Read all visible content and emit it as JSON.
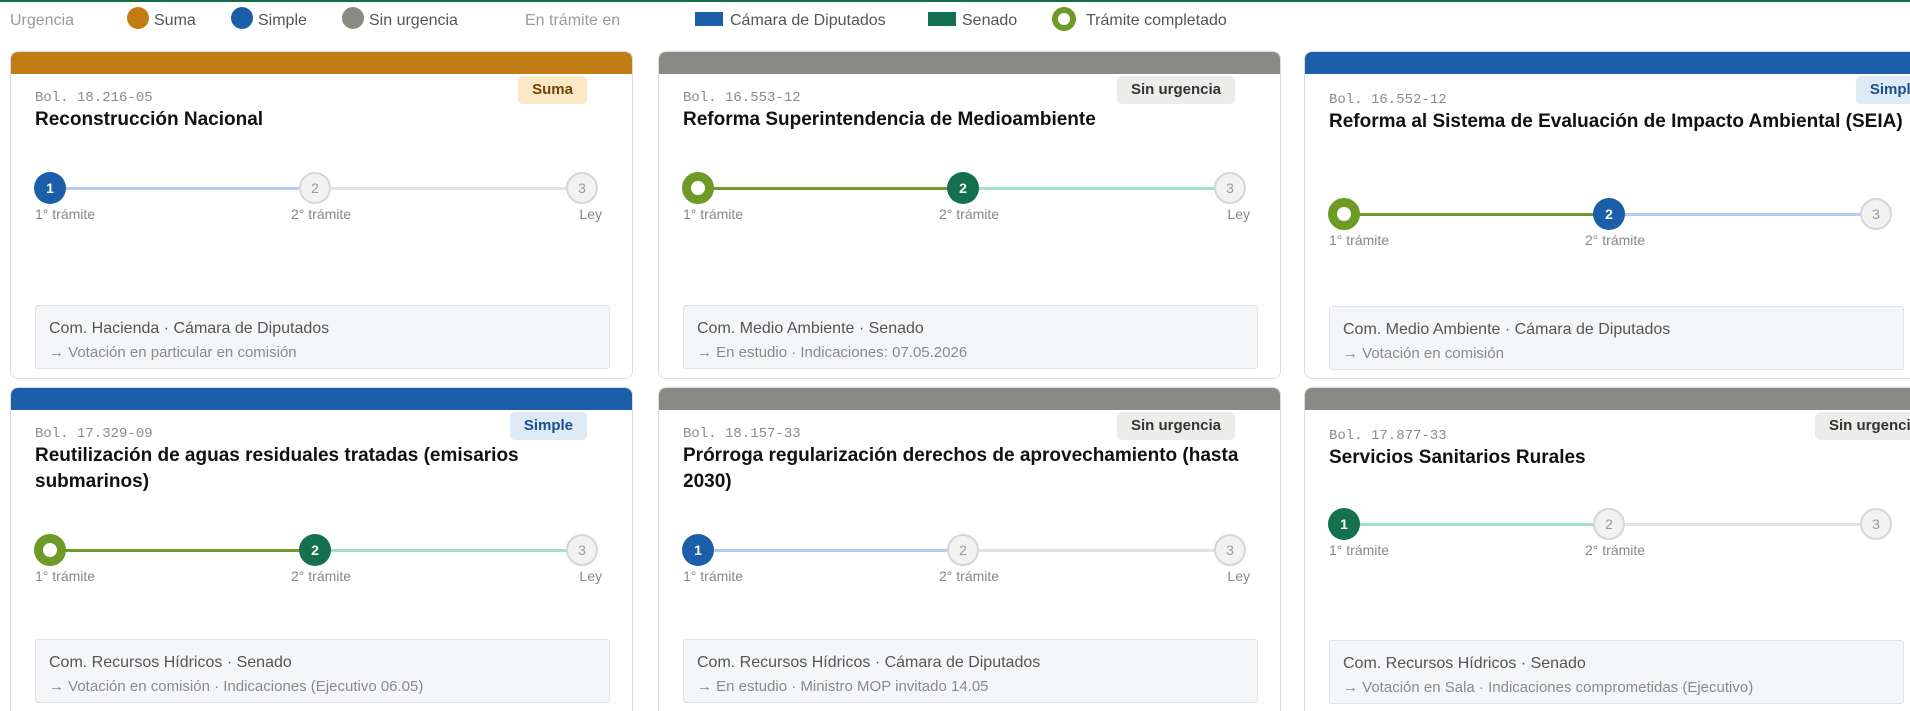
{
  "legend": {
    "urgencia_label": "Urgencia",
    "suma": "Suma",
    "simple": "Simple",
    "sin_urgencia": "Sin urgencia",
    "tramite_label": "En trámite en",
    "camara": "Cámara de Diputados",
    "senado": "Senado",
    "completado": "Trámite completado"
  },
  "colors": {
    "suma": "#c27c14",
    "simple": "#1b5faa",
    "sin_urgencia": "#8a8a84",
    "camara": "#1b5faa",
    "senado": "#14704f",
    "completado": "#6e9a27",
    "cam_progress": "#b5cdf0",
    "sen_progress": "#a4e2c8"
  },
  "stage_labels": [
    "1° trámite",
    "2° trámite",
    "Ley"
  ],
  "stage_numbers": [
    "1",
    "2",
    "3"
  ],
  "cards": [
    {
      "bol": "Bol. 18.216-05",
      "urgency": "Suma",
      "title": "Reconstrucción Nacional",
      "chamber": "camara",
      "current_stage": 1,
      "info": "Com. Hacienda · Cámara de Diputados",
      "next": "→  Votación en particular en comisión"
    },
    {
      "bol": "Bol. 16.553-12",
      "urgency": "Sin urgencia",
      "title": "Reforma Superintendencia de Medioambiente",
      "chamber": "senado",
      "current_stage": 2,
      "info": "Com. Medio Ambiente · Senado",
      "next": "→  En estudio · Indicaciones: 07.05.2026"
    },
    {
      "bol": "Bol. 16.552-12",
      "urgency": "Simple",
      "title": "Reforma al Sistema de Evaluación de Impacto Ambiental (SEIA)",
      "chamber": "camara",
      "current_stage": 2,
      "info": "Com. Medio Ambiente · Cámara de Diputados",
      "next": "→  Votación en comisión"
    },
    {
      "bol": "Bol. 17.329-09",
      "urgency": "Simple",
      "title": "Reutilización de aguas residuales tratadas (emisarios submarinos)",
      "chamber": "senado",
      "current_stage": 2,
      "info": "Com. Recursos Hídricos · Senado",
      "next": "→  Votación en comisión · Indicaciones (Ejecutivo 06.05)"
    },
    {
      "bol": "Bol. 18.157-33",
      "urgency": "Sin urgencia",
      "title": "Prórroga regularización derechos de aprovechamiento (hasta 2030)",
      "chamber": "camara",
      "current_stage": 1,
      "info": "Com. Recursos Hídricos · Cámara de Diputados",
      "next": "→  En estudio · Ministro MOP invitado 14.05"
    },
    {
      "bol": "Bol. 17.877-33",
      "urgency": "Sin urgencia",
      "title": "Servicios Sanitarios Rurales",
      "chamber": "senado",
      "current_stage": 1,
      "info": "Com. Recursos Hídricos · Senado",
      "next": "→  Votación en Sala · Indicaciones comprometidas (Ejecutivo)"
    }
  ]
}
